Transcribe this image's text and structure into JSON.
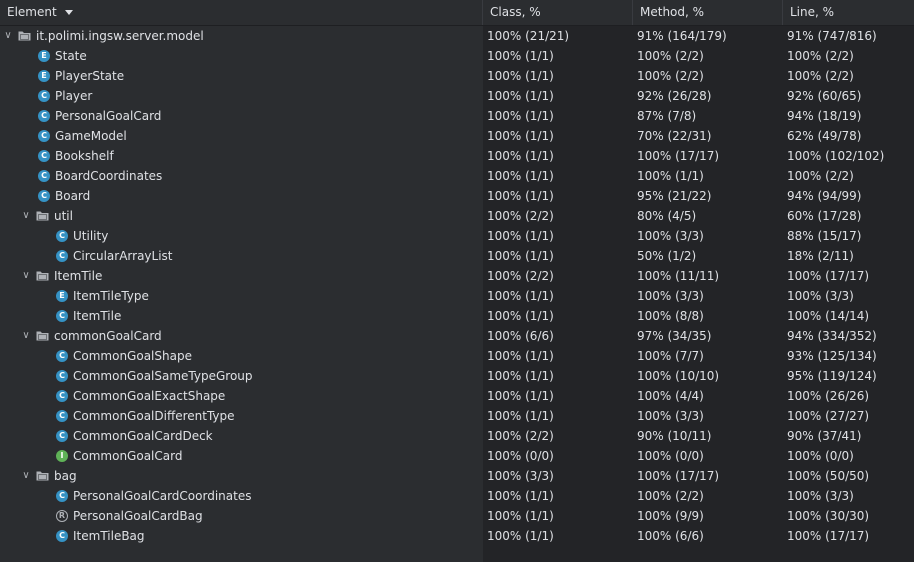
{
  "header": {
    "element": "Element",
    "class_pct": "Class, %",
    "method_pct": "Method, %",
    "line_pct": "Line, %"
  },
  "rows": [
    {
      "name": "it.polimi.ingsw.server.model",
      "kind": "package",
      "level": 0,
      "expanded": true,
      "class": "100% (21/21)",
      "method": "91% (164/179)",
      "line": "91% (747/816)"
    },
    {
      "name": "State",
      "kind": "enum",
      "badge": "E",
      "level": 1,
      "class": "100% (1/1)",
      "method": "100% (2/2)",
      "line": "100% (2/2)"
    },
    {
      "name": "PlayerState",
      "kind": "enum",
      "badge": "E",
      "level": 1,
      "class": "100% (1/1)",
      "method": "100% (2/2)",
      "line": "100% (2/2)"
    },
    {
      "name": "Player",
      "kind": "class",
      "badge": "C",
      "level": 1,
      "class": "100% (1/1)",
      "method": "92% (26/28)",
      "line": "92% (60/65)"
    },
    {
      "name": "PersonalGoalCard",
      "kind": "class",
      "badge": "C",
      "level": 1,
      "class": "100% (1/1)",
      "method": "87% (7/8)",
      "line": "94% (18/19)"
    },
    {
      "name": "GameModel",
      "kind": "class",
      "badge": "C",
      "level": 1,
      "class": "100% (1/1)",
      "method": "70% (22/31)",
      "line": "62% (49/78)"
    },
    {
      "name": "Bookshelf",
      "kind": "class",
      "badge": "C",
      "level": 1,
      "class": "100% (1/1)",
      "method": "100% (17/17)",
      "line": "100% (102/102)"
    },
    {
      "name": "BoardCoordinates",
      "kind": "class",
      "badge": "C",
      "level": 1,
      "class": "100% (1/1)",
      "method": "100% (1/1)",
      "line": "100% (2/2)"
    },
    {
      "name": "Board",
      "kind": "class",
      "badge": "C",
      "level": 1,
      "class": "100% (1/1)",
      "method": "95% (21/22)",
      "line": "94% (94/99)"
    },
    {
      "name": "util",
      "kind": "package",
      "level": 1,
      "expanded": true,
      "class": "100% (2/2)",
      "method": "80% (4/5)",
      "line": "60% (17/28)"
    },
    {
      "name": "Utility",
      "kind": "class",
      "badge": "C",
      "level": 2,
      "class": "100% (1/1)",
      "method": "100% (3/3)",
      "line": "88% (15/17)"
    },
    {
      "name": "CircularArrayList",
      "kind": "class",
      "badge": "C",
      "level": 2,
      "class": "100% (1/1)",
      "method": "50% (1/2)",
      "line": "18% (2/11)"
    },
    {
      "name": "ItemTile",
      "kind": "package",
      "level": 1,
      "expanded": true,
      "class": "100% (2/2)",
      "method": "100% (11/11)",
      "line": "100% (17/17)"
    },
    {
      "name": "ItemTileType",
      "kind": "enum",
      "badge": "E",
      "level": 2,
      "class": "100% (1/1)",
      "method": "100% (3/3)",
      "line": "100% (3/3)"
    },
    {
      "name": "ItemTile",
      "kind": "class",
      "badge": "C",
      "level": 2,
      "class": "100% (1/1)",
      "method": "100% (8/8)",
      "line": "100% (14/14)"
    },
    {
      "name": "commonGoalCard",
      "kind": "package",
      "level": 1,
      "expanded": true,
      "class": "100% (6/6)",
      "method": "97% (34/35)",
      "line": "94% (334/352)"
    },
    {
      "name": "CommonGoalShape",
      "kind": "class",
      "badge": "C",
      "level": 2,
      "class": "100% (1/1)",
      "method": "100% (7/7)",
      "line": "93% (125/134)"
    },
    {
      "name": "CommonGoalSameTypeGroup",
      "kind": "class",
      "badge": "C",
      "level": 2,
      "class": "100% (1/1)",
      "method": "100% (10/10)",
      "line": "95% (119/124)"
    },
    {
      "name": "CommonGoalExactShape",
      "kind": "class",
      "badge": "C",
      "level": 2,
      "class": "100% (1/1)",
      "method": "100% (4/4)",
      "line": "100% (26/26)"
    },
    {
      "name": "CommonGoalDifferentType",
      "kind": "class",
      "badge": "C",
      "level": 2,
      "class": "100% (1/1)",
      "method": "100% (3/3)",
      "line": "100% (27/27)"
    },
    {
      "name": "CommonGoalCardDeck",
      "kind": "class",
      "badge": "C",
      "level": 2,
      "class": "100% (2/2)",
      "method": "90% (10/11)",
      "line": "90% (37/41)"
    },
    {
      "name": "CommonGoalCard",
      "kind": "interface",
      "badge": "I",
      "level": 2,
      "class": "100% (0/0)",
      "method": "100% (0/0)",
      "line": "100% (0/0)"
    },
    {
      "name": "bag",
      "kind": "package",
      "level": 1,
      "expanded": true,
      "class": "100% (3/3)",
      "method": "100% (17/17)",
      "line": "100% (50/50)"
    },
    {
      "name": "PersonalGoalCardCoordinates",
      "kind": "class",
      "badge": "C",
      "level": 2,
      "class": "100% (1/1)",
      "method": "100% (2/2)",
      "line": "100% (3/3)"
    },
    {
      "name": "PersonalGoalCardBag",
      "kind": "record",
      "badge": "R",
      "level": 2,
      "class": "100% (1/1)",
      "method": "100% (9/9)",
      "line": "100% (30/30)"
    },
    {
      "name": "ItemTileBag",
      "kind": "class",
      "badge": "C",
      "level": 2,
      "class": "100% (1/1)",
      "method": "100% (6/6)",
      "line": "100% (17/17)"
    }
  ],
  "colors": {
    "background": "#2b2d30",
    "coverage_column_bg": "#232427",
    "class_badge": "#3592c4",
    "interface_badge": "#5fb257",
    "text": "#dfe1e5"
  }
}
